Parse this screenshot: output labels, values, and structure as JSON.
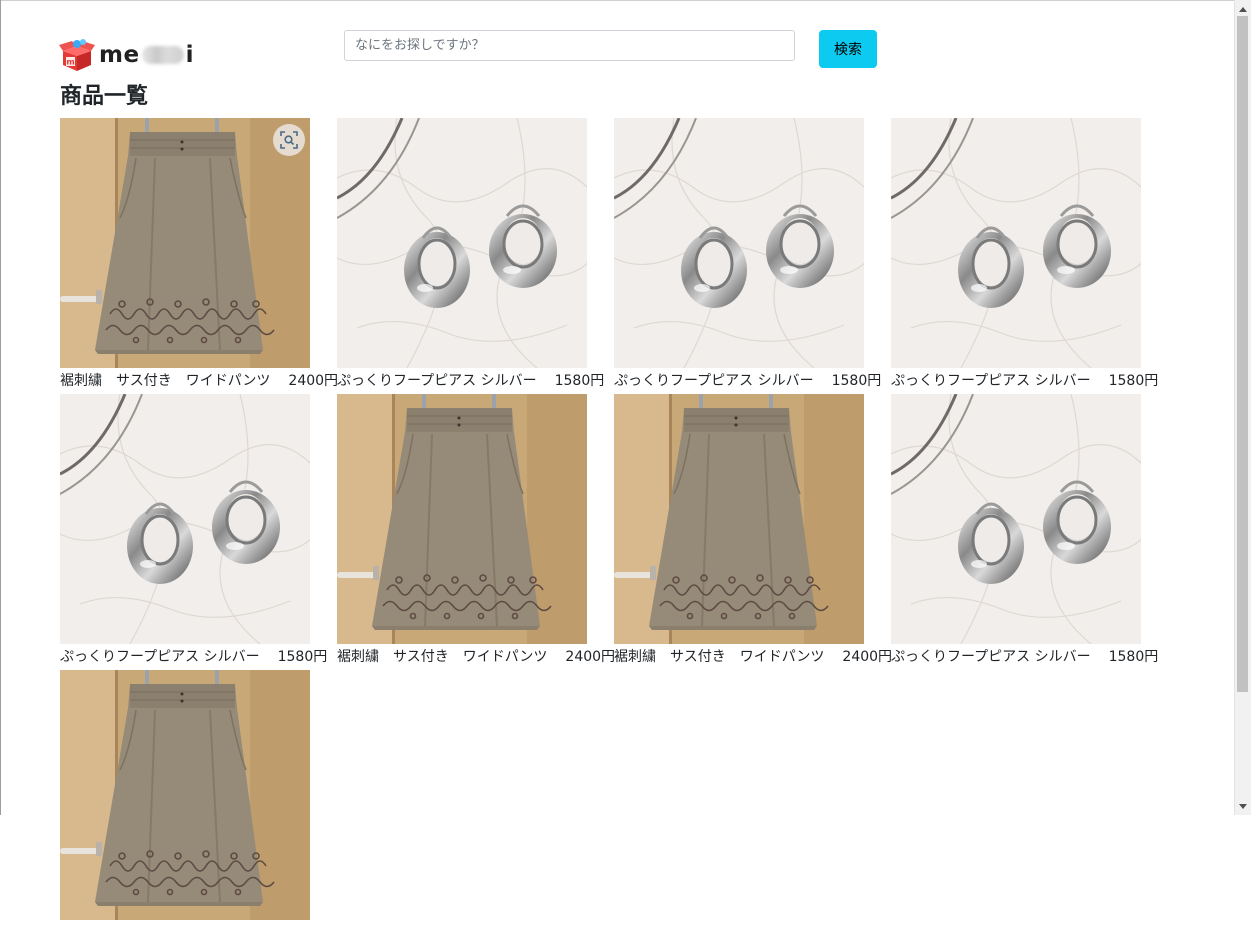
{
  "header": {
    "logo_text_start": "me",
    "logo_text_end": "i",
    "search_placeholder": "なにをお探しですか？",
    "search_button_label": "検索"
  },
  "page_title": "商品一覧",
  "products": [
    {
      "name": "裾刺繍　サス付き　ワイドパンツ",
      "price": "2400円",
      "image": "pants-image"
    },
    {
      "name": "ぷっくりフープピアス シルバー",
      "price": "1580円",
      "image": "earrings-image"
    },
    {
      "name": "ぷっくりフープピアス シルバー",
      "price": "1580円",
      "image": "earrings-image"
    },
    {
      "name": "ぷっくりフープピアス シルバー",
      "price": "1580円",
      "image": "earrings-image"
    },
    {
      "name": "ぷっくりフープピアス シルバー",
      "price": "1580円",
      "image": "earrings-image"
    },
    {
      "name": "裾刺繍　サス付き　ワイドパンツ",
      "price": "2400円",
      "image": "pants-image"
    },
    {
      "name": "裾刺繍　サス付き　ワイドパンツ",
      "price": "2400円",
      "image": "pants-image"
    },
    {
      "name": "ぷっくりフープピアス シルバー",
      "price": "1580円",
      "image": "earrings-image"
    },
    {
      "name": "",
      "price": "",
      "image": "pants-image"
    }
  ],
  "icons": {
    "lens": "visual-search-icon",
    "logo": "box-logo-icon",
    "scroll_up": "scroll-up-arrow-icon",
    "scroll_down": "scroll-down-arrow-icon"
  },
  "colors": {
    "search_button": "#0dcaf0",
    "logo_red": "#e53935",
    "logo_blue": "#3ea8f4"
  }
}
